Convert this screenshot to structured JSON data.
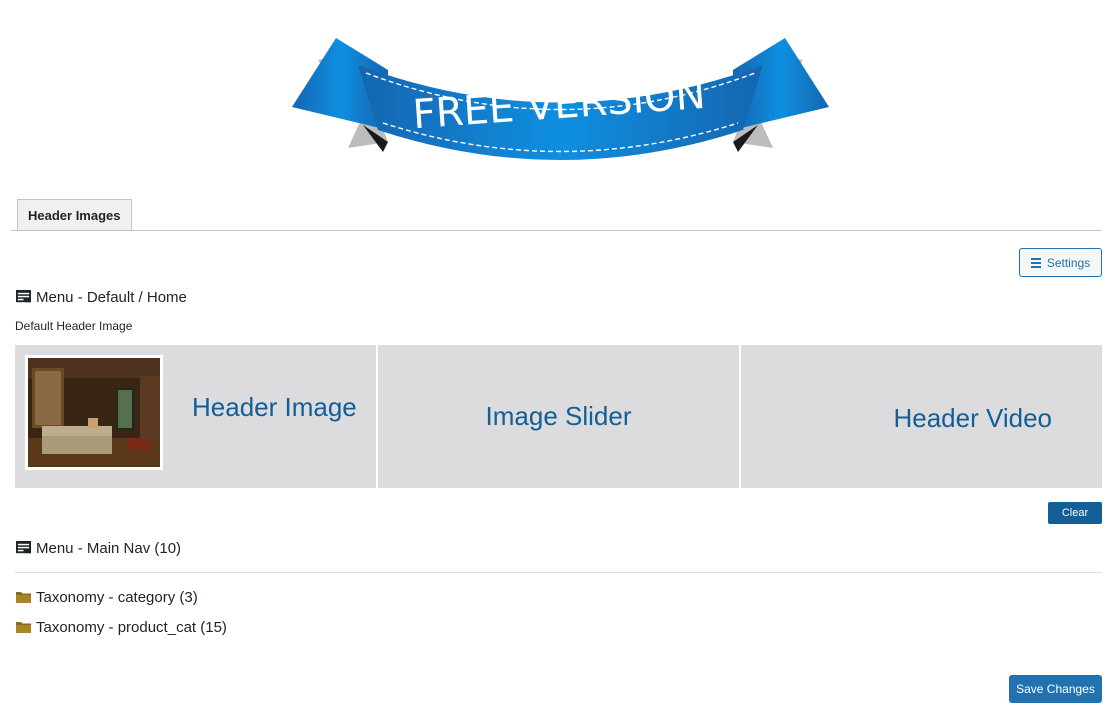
{
  "banner": {
    "text": "FREE VERSION"
  },
  "tabs": [
    {
      "label": "Header Images"
    }
  ],
  "toolbar": {
    "settings_label": "Settings"
  },
  "sections": [
    {
      "title": "Menu - Default / Home",
      "sub_label": "Default Header Image",
      "options": [
        {
          "label": "Header Image"
        },
        {
          "label": "Image Slider"
        },
        {
          "label": "Header Video"
        }
      ],
      "clear_label": "Clear"
    },
    {
      "title": "Menu - Main Nav (10)"
    },
    {
      "title": "Taxonomy - category (3)"
    },
    {
      "title": "Taxonomy - product_cat (15)"
    }
  ],
  "footer": {
    "save_label": "Save Changes"
  },
  "colors": {
    "primary": "#2271b1",
    "dark_primary": "#135e96",
    "option_bg": "#dcdcde",
    "folder": "#8a6a1c"
  }
}
